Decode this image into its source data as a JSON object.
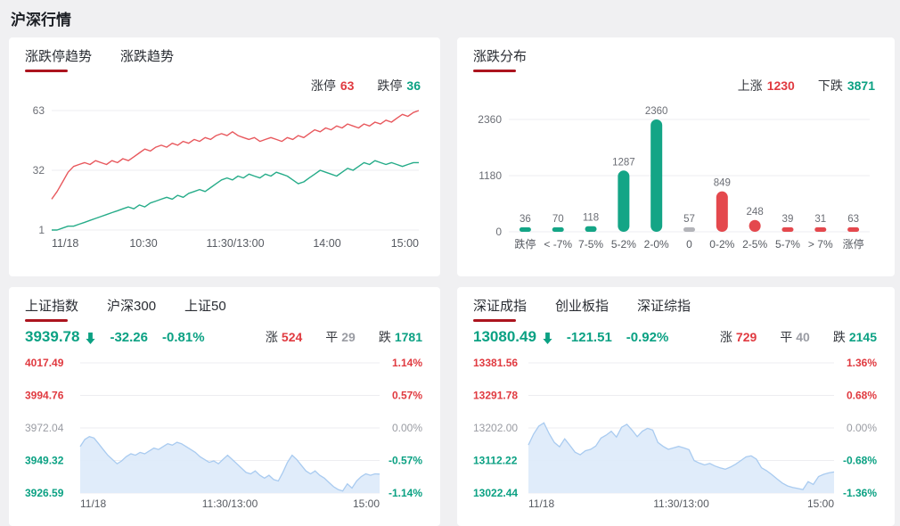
{
  "page": {
    "title": "沪深行情"
  },
  "colors": {
    "up": "#e03a40",
    "down": "#0ba183",
    "neutral": "#9a9ca3",
    "accent_underline": "#ac141e",
    "line_red": "#e8585d",
    "line_green": "#26ac89",
    "bar_gray": "#b3b4b9",
    "area_line": "#a9cbf0",
    "area_fill": "#ddeafa",
    "grid": "#ededf0"
  },
  "limit_trend_panel": {
    "tabs": [
      {
        "label": "涨跌停趋势"
      },
      {
        "label": "涨跌趋势"
      }
    ],
    "legend": [
      {
        "label": "涨停",
        "value": "63",
        "color": "up"
      },
      {
        "label": "跌停",
        "value": "36",
        "color": "down"
      }
    ]
  },
  "distribution_panel": {
    "tab": "涨跌分布",
    "legend": [
      {
        "label": "上涨",
        "value": "1230",
        "color": "up"
      },
      {
        "label": "下跌",
        "value": "3871",
        "color": "down"
      }
    ]
  },
  "sh_panel": {
    "tabs": [
      {
        "label": "上证指数"
      },
      {
        "label": "沪深300"
      },
      {
        "label": "上证50"
      }
    ],
    "price": "3939.78",
    "trend_icon": "down-arrow",
    "change": "-32.26",
    "pct": "-0.81%",
    "stats": [
      {
        "label": "涨",
        "value": "524",
        "color": "up"
      },
      {
        "label": "平",
        "value": "29",
        "color": "neutral"
      },
      {
        "label": "跌",
        "value": "1781",
        "color": "down"
      }
    ]
  },
  "sz_panel": {
    "tabs": [
      {
        "label": "深证成指"
      },
      {
        "label": "创业板指"
      },
      {
        "label": "深证综指"
      }
    ],
    "price": "13080.49",
    "trend_icon": "down-arrow",
    "change": "-121.51",
    "pct": "-0.92%",
    "stats": [
      {
        "label": "涨",
        "value": "729",
        "color": "up"
      },
      {
        "label": "平",
        "value": "40",
        "color": "neutral"
      },
      {
        "label": "跌",
        "value": "2145",
        "color": "down"
      }
    ]
  },
  "chart_data": [
    {
      "id": "limit-trend",
      "type": "line",
      "title": "涨跌停趋势",
      "x_ticks": [
        "11/18",
        "10:30",
        "11:30/13:00",
        "14:00",
        "15:00"
      ],
      "y_ticks": [
        63,
        32,
        1
      ],
      "ylim": [
        1,
        63
      ],
      "grid": true,
      "legend_position": "top-right",
      "series": [
        {
          "name": "涨停",
          "color": "#e8585d",
          "values": [
            17,
            21,
            26,
            31,
            34,
            35,
            36,
            35,
            37,
            36,
            35,
            37,
            36,
            38,
            37,
            39,
            41,
            43,
            42,
            44,
            45,
            44,
            46,
            45,
            47,
            46,
            48,
            47,
            49,
            48,
            50,
            51,
            50,
            52,
            50,
            49,
            48,
            49,
            47,
            48,
            49,
            48,
            47,
            49,
            48,
            50,
            49,
            51,
            53,
            52,
            54,
            53,
            55,
            54,
            56,
            55,
            54,
            56,
            55,
            57,
            56,
            58,
            57,
            59,
            61,
            60,
            62,
            63
          ]
        },
        {
          "name": "跌停",
          "color": "#26ac89",
          "values": [
            1,
            1,
            2,
            3,
            3,
            4,
            5,
            6,
            7,
            8,
            9,
            10,
            11,
            12,
            13,
            12,
            14,
            13,
            15,
            16,
            17,
            18,
            17,
            19,
            18,
            20,
            21,
            22,
            21,
            23,
            25,
            27,
            28,
            27,
            29,
            28,
            30,
            29,
            28,
            30,
            29,
            31,
            30,
            29,
            27,
            25,
            26,
            28,
            30,
            32,
            31,
            30,
            29,
            31,
            33,
            32,
            34,
            36,
            35,
            37,
            36,
            35,
            36,
            35,
            34,
            35,
            36,
            36
          ]
        }
      ]
    },
    {
      "id": "distribution",
      "type": "bar",
      "title": "涨跌分布",
      "categories": [
        "跌停",
        "< -7%",
        "7-5%",
        "5-2%",
        "2-0%",
        "0",
        "0-2%",
        "2-5%",
        "5-7%",
        "> 7%",
        "涨停"
      ],
      "values": [
        36,
        70,
        118,
        1287,
        2360,
        57,
        849,
        248,
        39,
        31,
        63
      ],
      "bar_colors": [
        "#14a586",
        "#14a586",
        "#14a586",
        "#14a586",
        "#14a586",
        "#b3b4b9",
        "#e4484d",
        "#e4484d",
        "#e4484d",
        "#e4484d",
        "#e4484d"
      ],
      "y_ticks": [
        2360,
        1180,
        0
      ],
      "ylim": [
        0,
        2360
      ],
      "grid": true
    },
    {
      "id": "sh-index",
      "type": "area",
      "title": "上证指数",
      "x_ticks": [
        "11/18",
        "11:30/13:00",
        "15:00"
      ],
      "y_ticks_left": [
        "4017.49",
        "3994.76",
        "3972.04",
        "3949.32",
        "3926.59"
      ],
      "y_ticks_right": [
        "1.14%",
        "0.57%",
        "0.00%",
        "-0.57%",
        "-1.14%"
      ],
      "tick_classes": [
        "up",
        "up",
        "neutral",
        "down",
        "down"
      ],
      "ylim": [
        3926.59,
        4017.49
      ],
      "grid": true,
      "values": [
        3959,
        3964,
        3966,
        3965,
        3961,
        3957,
        3953,
        3950,
        3947,
        3949,
        3952,
        3954,
        3953,
        3955,
        3954,
        3956,
        3958,
        3957,
        3959,
        3961,
        3960,
        3962,
        3961,
        3959,
        3957,
        3955,
        3952,
        3950,
        3948,
        3949,
        3947,
        3950,
        3953,
        3950,
        3947,
        3944,
        3941,
        3940,
        3942,
        3939,
        3937,
        3939,
        3936,
        3935,
        3941,
        3948,
        3953,
        3950,
        3946,
        3942,
        3940,
        3942,
        3939,
        3937,
        3934,
        3931,
        3929,
        3928,
        3933,
        3930,
        3935,
        3938,
        3940,
        3939,
        3940,
        3939.78
      ]
    },
    {
      "id": "sz-index",
      "type": "area",
      "title": "深证成指",
      "x_ticks": [
        "11/18",
        "11:30/13:00",
        "15:00"
      ],
      "y_ticks_left": [
        "13381.56",
        "13291.78",
        "13202.00",
        "13112.22",
        "13022.44"
      ],
      "y_ticks_right": [
        "1.36%",
        "0.68%",
        "0.00%",
        "-0.68%",
        "-1.36%"
      ],
      "tick_classes": [
        "up",
        "up",
        "neutral",
        "down",
        "down"
      ],
      "ylim": [
        13022.44,
        13381.56
      ],
      "grid": true,
      "values": [
        13155,
        13185,
        13207,
        13216,
        13186,
        13162,
        13150,
        13172,
        13154,
        13135,
        13128,
        13139,
        13143,
        13152,
        13174,
        13182,
        13193,
        13177,
        13204,
        13212,
        13196,
        13178,
        13193,
        13201,
        13196,
        13162,
        13151,
        13143,
        13147,
        13151,
        13147,
        13142,
        13112,
        13105,
        13100,
        13104,
        13097,
        13092,
        13088,
        13094,
        13102,
        13112,
        13122,
        13125,
        13116,
        13092,
        13084,
        13073,
        13061,
        13050,
        13042,
        13038,
        13035,
        13032,
        13054,
        13046,
        13068,
        13074,
        13078,
        13080.49
      ]
    }
  ]
}
